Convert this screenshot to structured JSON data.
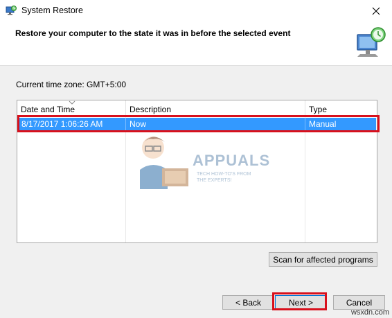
{
  "window": {
    "title": "System Restore"
  },
  "header": {
    "heading": "Restore your computer to the state it was in before the selected event"
  },
  "timezone_text": "Current time zone: GMT+5:00",
  "restore_list": {
    "columns": [
      "Date and Time",
      "Description",
      "Type"
    ],
    "sorted_column": "Date and Time",
    "rows": [
      {
        "date_time": "8/17/2017 1:06:26 AM",
        "description": "Now",
        "type": "Manual",
        "selected": true
      }
    ]
  },
  "watermark": {
    "brand": "APPUALS",
    "tagline": "TECH HOW-TO'S FROM THE EXPERTS!"
  },
  "buttons": {
    "scan": "Scan for affected programs",
    "back": "< Back",
    "next": "Next >",
    "cancel": "Cancel"
  },
  "site_mark": "wsxdn.com",
  "colors": {
    "selection": "#3399ff",
    "annotation_red": "#d8101c",
    "dialog_bg": "#f0f0f0"
  },
  "icons": {
    "title": "system-restore-icon",
    "header": "monitor-restore-icon",
    "close": "close-icon"
  }
}
